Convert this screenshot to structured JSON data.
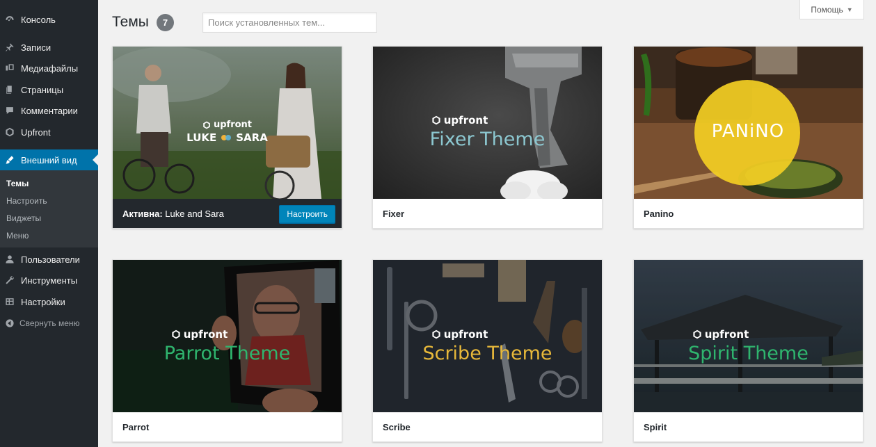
{
  "sidebar": {
    "items": [
      {
        "label": "Консоль",
        "icon": "dashboard-icon"
      },
      {
        "label": "Записи",
        "icon": "pin-icon"
      },
      {
        "label": "Медиафайлы",
        "icon": "media-icon"
      },
      {
        "label": "Страницы",
        "icon": "pages-icon"
      },
      {
        "label": "Комментарии",
        "icon": "comments-icon"
      },
      {
        "label": "Upfront",
        "icon": "upfront-hex-icon"
      },
      {
        "label": "Внешний вид",
        "icon": "appearance-icon"
      },
      {
        "label": "Пользователи",
        "icon": "users-icon"
      },
      {
        "label": "Инструменты",
        "icon": "tools-icon"
      },
      {
        "label": "Настройки",
        "icon": "settings-icon"
      }
    ],
    "submenu": [
      "Темы",
      "Настроить",
      "Виджеты",
      "Меню"
    ],
    "collapse_label": "Свернуть меню"
  },
  "header": {
    "title": "Темы",
    "count": "7",
    "search_placeholder": "Поиск установленных тем...",
    "help_label": "Помощь"
  },
  "themes": [
    {
      "name": "Luke and Sara",
      "active_prefix": "Активна:",
      "customize_label": "Настроить",
      "brand": "upfront",
      "shot_left": "LUKE",
      "shot_right": "SARA"
    },
    {
      "name": "Fixer",
      "brand": "upfront",
      "shot_title": "Fixer Theme"
    },
    {
      "name": "Panino",
      "shot_title": "PANiNO"
    },
    {
      "name": "Parrot",
      "brand": "upfront",
      "shot_title": "Parrot Theme"
    },
    {
      "name": "Scribe",
      "brand": "upfront",
      "shot_title": "Scribe Theme"
    },
    {
      "name": "Spirit",
      "brand": "upfront",
      "shot_title": "Spirit Theme"
    }
  ],
  "colors": {
    "sidebar_bg": "#23282d",
    "accent": "#0073aa",
    "button": "#0085ba",
    "fixer_title": "#8cc7d0",
    "panino_circle": "#f2cd23",
    "green_title": "#2fb56e",
    "scribe_title": "#e7b83a"
  }
}
